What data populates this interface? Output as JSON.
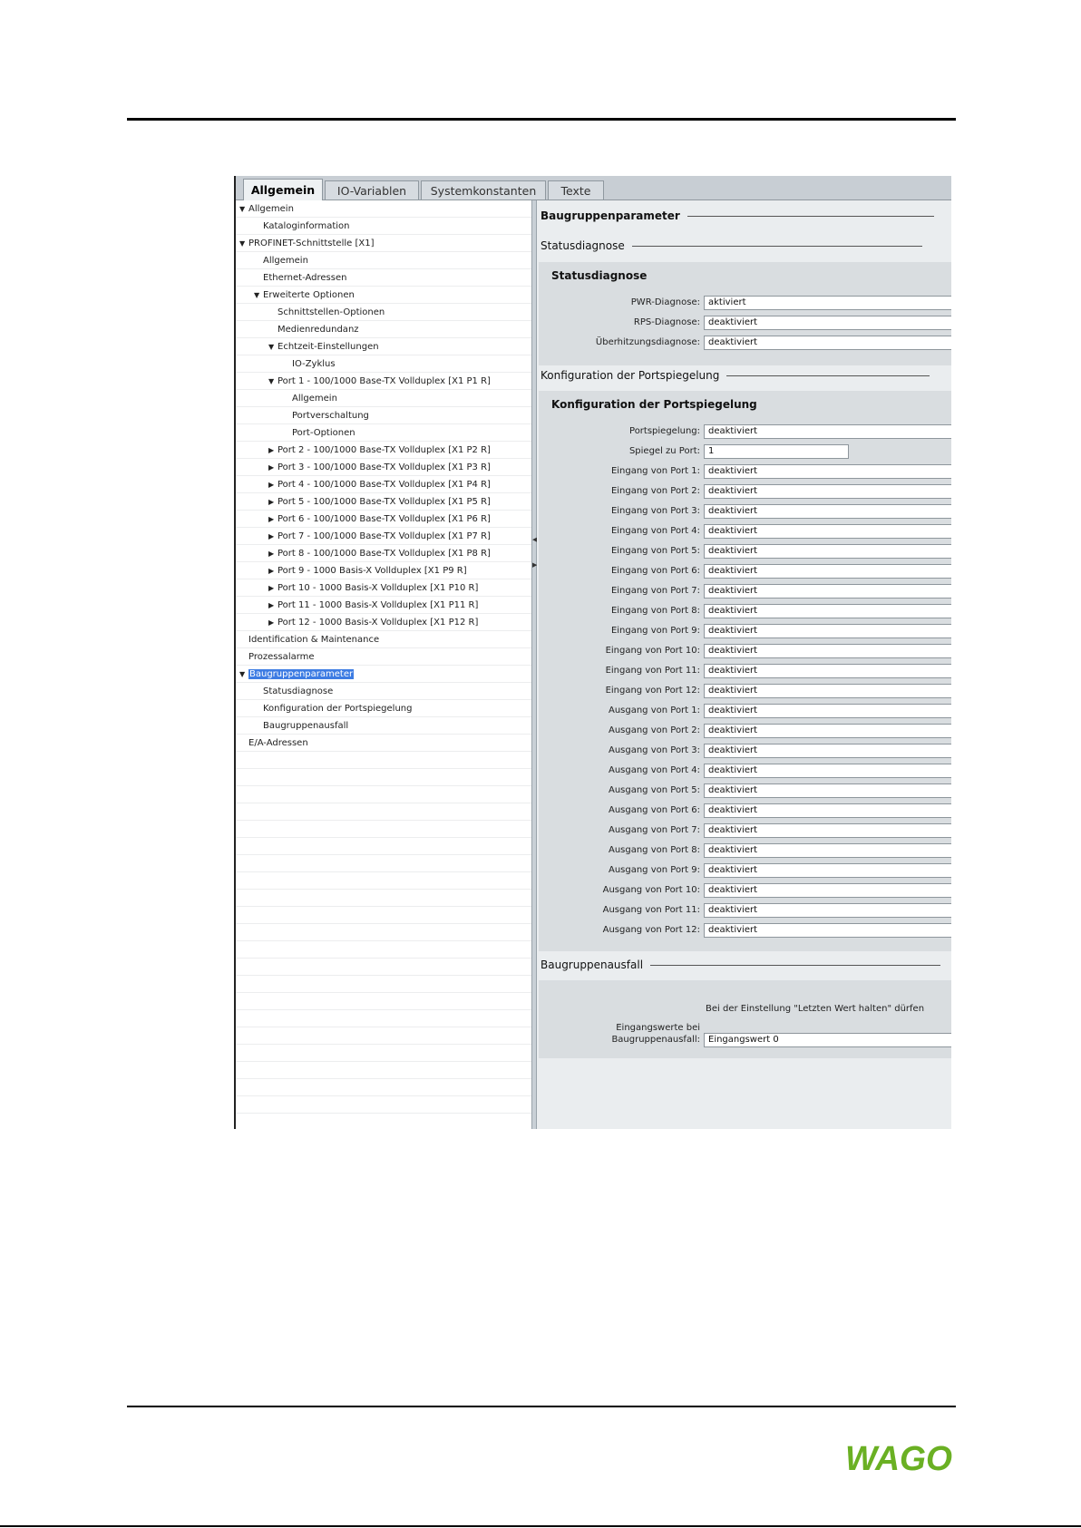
{
  "tabs": [
    "Allgemein",
    "IO-Variablen",
    "Systemkonstanten",
    "Texte"
  ],
  "tree": [
    {
      "label": "Allgemein",
      "level": 0,
      "toggle": "expanded"
    },
    {
      "label": "Kataloginformation",
      "level": 1,
      "toggle": ""
    },
    {
      "label": "PROFINET-Schnittstelle [X1]",
      "level": 0,
      "toggle": "expanded"
    },
    {
      "label": "Allgemein",
      "level": 1,
      "toggle": ""
    },
    {
      "label": "Ethernet-Adressen",
      "level": 1,
      "toggle": ""
    },
    {
      "label": "Erweiterte Optionen",
      "level": 1,
      "toggle": "expanded"
    },
    {
      "label": "Schnittstellen-Optionen",
      "level": 2,
      "toggle": ""
    },
    {
      "label": "Medienredundanz",
      "level": 2,
      "toggle": ""
    },
    {
      "label": "Echtzeit-Einstellungen",
      "level": 2,
      "toggle": "expanded"
    },
    {
      "label": "IO-Zyklus",
      "level": 3,
      "toggle": ""
    },
    {
      "label": "Port 1 - 100/1000 Base-TX Vollduplex [X1 P1 R]",
      "level": 2,
      "toggle": "expanded"
    },
    {
      "label": "Allgemein",
      "level": 3,
      "toggle": ""
    },
    {
      "label": "Portverschaltung",
      "level": 3,
      "toggle": ""
    },
    {
      "label": "Port-Optionen",
      "level": 3,
      "toggle": ""
    },
    {
      "label": "Port 2 - 100/1000 Base-TX Vollduplex [X1 P2 R]",
      "level": 2,
      "toggle": "collapsed"
    },
    {
      "label": "Port 3 - 100/1000 Base-TX Vollduplex [X1 P3 R]",
      "level": 2,
      "toggle": "collapsed"
    },
    {
      "label": "Port 4 - 100/1000 Base-TX Vollduplex [X1 P4 R]",
      "level": 2,
      "toggle": "collapsed"
    },
    {
      "label": "Port 5 - 100/1000 Base-TX Vollduplex [X1 P5 R]",
      "level": 2,
      "toggle": "collapsed"
    },
    {
      "label": "Port 6 - 100/1000 Base-TX Vollduplex [X1 P6 R]",
      "level": 2,
      "toggle": "collapsed"
    },
    {
      "label": "Port 7 - 100/1000 Base-TX Vollduplex [X1 P7 R]",
      "level": 2,
      "toggle": "collapsed"
    },
    {
      "label": "Port 8 - 100/1000 Base-TX Vollduplex [X1 P8 R]",
      "level": 2,
      "toggle": "collapsed"
    },
    {
      "label": "Port 9 - 1000 Basis-X Vollduplex [X1 P9 R]",
      "level": 2,
      "toggle": "collapsed"
    },
    {
      "label": "Port 10 - 1000 Basis-X Vollduplex [X1 P10 R]",
      "level": 2,
      "toggle": "collapsed"
    },
    {
      "label": "Port 11 - 1000 Basis-X Vollduplex [X1 P11 R]",
      "level": 2,
      "toggle": "collapsed"
    },
    {
      "label": "Port 12 - 1000 Basis-X Vollduplex [X1 P12 R]",
      "level": 2,
      "toggle": "collapsed"
    },
    {
      "label": "Identification & Maintenance",
      "level": 0,
      "toggle": ""
    },
    {
      "label": "Prozessalarme",
      "level": 0,
      "toggle": ""
    },
    {
      "label": "Baugruppenparameter",
      "level": 0,
      "toggle": "expanded",
      "selected": true
    },
    {
      "label": "Statusdiagnose",
      "level": 1,
      "toggle": ""
    },
    {
      "label": "Konfiguration der Portspiegelung",
      "level": 1,
      "toggle": ""
    },
    {
      "label": "Baugruppenausfall",
      "level": 1,
      "toggle": ""
    },
    {
      "label": "E/A-Adressen",
      "level": 0,
      "toggle": ""
    }
  ],
  "params": {
    "header": "Baugruppenparameter",
    "status": {
      "section": "Statusdiagnose",
      "box_title": "Statusdiagnose",
      "fields": [
        {
          "label": "PWR-Diagnose:",
          "value": "aktiviert"
        },
        {
          "label": "RPS-Diagnose:",
          "value": "deaktiviert"
        },
        {
          "label": "Überhitzungsdiagnose:",
          "value": "deaktiviert"
        }
      ]
    },
    "mirror": {
      "section": "Konfiguration der Portspiegelung",
      "box_title": "Konfiguration der Portspiegelung",
      "fields": [
        {
          "label": "Portspiegelung:",
          "value": "deaktiviert"
        },
        {
          "label": "Spiegel zu Port:",
          "value": "1",
          "short": true
        },
        {
          "label": "Eingang von Port 1:",
          "value": "deaktiviert"
        },
        {
          "label": "Eingang von Port 2:",
          "value": "deaktiviert"
        },
        {
          "label": "Eingang von Port 3:",
          "value": "deaktiviert"
        },
        {
          "label": "Eingang von Port 4:",
          "value": "deaktiviert"
        },
        {
          "label": "Eingang von Port 5:",
          "value": "deaktiviert"
        },
        {
          "label": "Eingang von Port 6:",
          "value": "deaktiviert"
        },
        {
          "label": "Eingang von Port 7:",
          "value": "deaktiviert"
        },
        {
          "label": "Eingang von Port 8:",
          "value": "deaktiviert"
        },
        {
          "label": "Eingang von Port 9:",
          "value": "deaktiviert"
        },
        {
          "label": "Eingang von Port 10:",
          "value": "deaktiviert"
        },
        {
          "label": "Eingang von Port 11:",
          "value": "deaktiviert"
        },
        {
          "label": "Eingang von Port 12:",
          "value": "deaktiviert"
        },
        {
          "label": "Ausgang von Port 1:",
          "value": "deaktiviert"
        },
        {
          "label": "Ausgang von Port 2:",
          "value": "deaktiviert"
        },
        {
          "label": "Ausgang von Port 3:",
          "value": "deaktiviert"
        },
        {
          "label": "Ausgang von Port 4:",
          "value": "deaktiviert"
        },
        {
          "label": "Ausgang von Port 5:",
          "value": "deaktiviert"
        },
        {
          "label": "Ausgang von Port 6:",
          "value": "deaktiviert"
        },
        {
          "label": "Ausgang von Port 7:",
          "value": "deaktiviert"
        },
        {
          "label": "Ausgang von Port 8:",
          "value": "deaktiviert"
        },
        {
          "label": "Ausgang von Port 9:",
          "value": "deaktiviert"
        },
        {
          "label": "Ausgang von Port 10:",
          "value": "deaktiviert"
        },
        {
          "label": "Ausgang von Port 11:",
          "value": "deaktiviert"
        },
        {
          "label": "Ausgang von Port 12:",
          "value": "deaktiviert"
        }
      ]
    },
    "failure": {
      "section": "Baugruppenausfall",
      "note": "Bei der Einstellung \"Letzten Wert halten\" dürfen",
      "label_line1": "Eingangswerte bei",
      "label_line2": "Baugruppenausfall:",
      "value": "Eingangswert 0"
    }
  },
  "logo": {
    "text": "WAGO",
    "color": "#6ab023"
  }
}
